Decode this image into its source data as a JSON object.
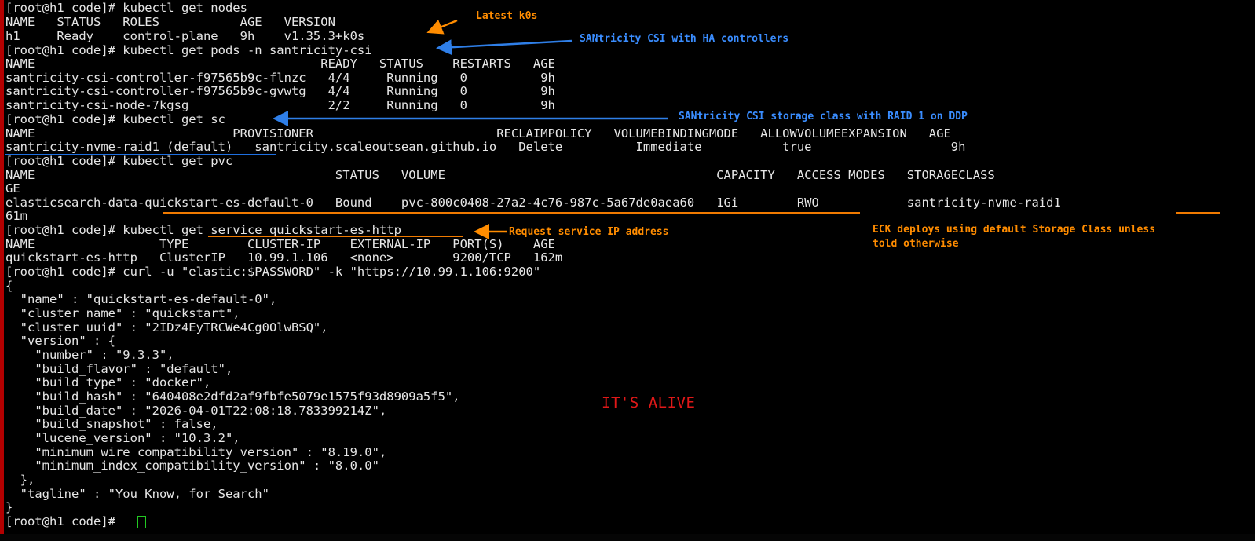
{
  "terminal": {
    "lines": [
      "[root@h1 code]# kubectl get nodes",
      "NAME   STATUS   ROLES           AGE   VERSION",
      "h1     Ready    control-plane   9h    v1.35.3+k0s",
      "[root@h1 code]# kubectl get pods -n santricity-csi",
      "NAME                                       READY   STATUS    RESTARTS   AGE",
      "santricity-csi-controller-f97565b9c-flnzc   4/4     Running   0          9h",
      "santricity-csi-controller-f97565b9c-gvwtg   4/4     Running   0          9h",
      "santricity-csi-node-7kgsg                   2/2     Running   0          9h",
      "[root@h1 code]# kubectl get sc",
      "NAME                           PROVISIONER                         RECLAIMPOLICY   VOLUMEBINDINGMODE   ALLOWVOLUMEEXPANSION   AGE",
      "santricity-nvme-raid1 (default)   santricity.scaleoutsean.github.io   Delete          Immediate           true                   9h",
      "[root@h1 code]# kubectl get pvc",
      "NAME                                         STATUS   VOLUME                                     CAPACITY   ACCESS MODES   STORAGECLASS",
      "GE",
      "elasticsearch-data-quickstart-es-default-0   Bound    pvc-800c0408-27a2-4c76-987c-5a67de0aea60   1Gi        RWO            santricity-nvme-raid1",
      "61m",
      "[root@h1 code]# kubectl get service quickstart-es-http",
      "NAME                 TYPE        CLUSTER-IP    EXTERNAL-IP   PORT(S)    AGE",
      "quickstart-es-http   ClusterIP   10.99.1.106   <none>        9200/TCP   162m",
      "[root@h1 code]# curl -u \"elastic:$PASSWORD\" -k \"https://10.99.1.106:9200\"",
      "{",
      "  \"name\" : \"quickstart-es-default-0\",",
      "  \"cluster_name\" : \"quickstart\",",
      "  \"cluster_uuid\" : \"2IDz4EyTRCWe4Cg0OlwBSQ\",",
      "  \"version\" : {",
      "    \"number\" : \"9.3.3\",",
      "    \"build_flavor\" : \"default\",",
      "    \"build_type\" : \"docker\",",
      "    \"build_hash\" : \"640408e2dfd2af9fbfe5079e1575f93d8909a5f5\",",
      "    \"build_date\" : \"2026-04-01T22:08:18.783399214Z\",",
      "    \"build_snapshot\" : false,",
      "    \"lucene_version\" : \"10.3.2\",",
      "    \"minimum_wire_compatibility_version\" : \"8.19.0\",",
      "    \"minimum_index_compatibility_version\" : \"8.0.0\"",
      "  },",
      "  \"tagline\" : \"You Know, for Search\"",
      "}",
      "[root@h1 code]# "
    ],
    "colors": {
      "text": "#e6e6e6",
      "background": "#000000",
      "annotation_orange": "#ff8c00",
      "annotation_blue": "#3a8dff",
      "annotation_red": "#e01818",
      "cursor": "#22c922"
    }
  },
  "annotations": {
    "latest_k0s": "Latest k0s",
    "santricity_csi_ha": "SANtricity CSI with HA controllers",
    "santricity_sc_raid": "SANtricity CSI storage class with RAID 1 on DDP",
    "request_ip": "Request service IP address",
    "eck_default_sc_line1": "ECK deploys using default Storage Class unless",
    "eck_default_sc_line2": "told otherwise",
    "its_alive": "IT'S ALIVE"
  }
}
